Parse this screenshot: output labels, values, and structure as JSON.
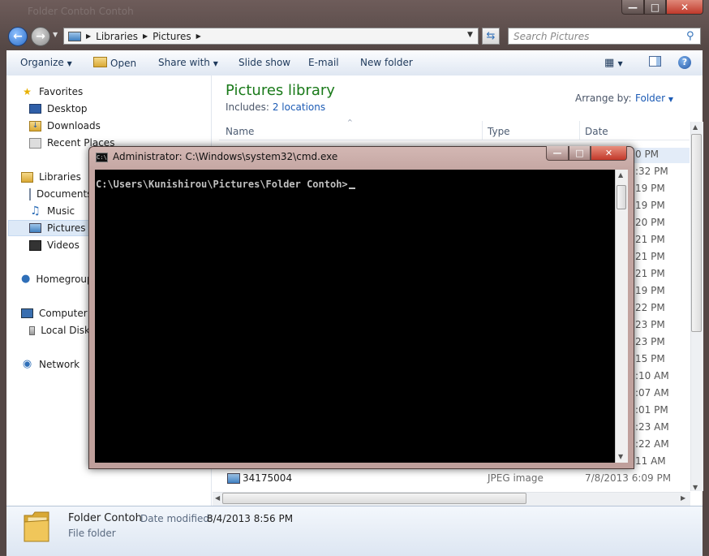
{
  "explorer": {
    "title_ghost": "Folder Contoh Contoh",
    "breadcrumb": [
      "Libraries",
      "Pictures"
    ],
    "search_placeholder": "Search Pictures",
    "toolbar": {
      "organize": "Organize",
      "open": "Open",
      "share_with": "Share with",
      "slide_show": "Slide show",
      "email": "E-mail",
      "new_folder": "New folder"
    },
    "nav": {
      "favorites": "Favorites",
      "desktop": "Desktop",
      "downloads": "Downloads",
      "recent_places": "Recent Places",
      "libraries": "Libraries",
      "documents": "Documents",
      "music": "Music",
      "pictures": "Pictures",
      "videos": "Videos",
      "homegroup": "Homegroup",
      "computer": "Computer",
      "local_disk": "Local Disk",
      "network": "Network"
    },
    "library": {
      "title": "Pictures library",
      "includes_label": "Includes:",
      "includes_link": "2 locations",
      "arrange_label": "Arrange by:",
      "arrange_value": "Folder"
    },
    "columns": {
      "name": "Name",
      "type": "Type",
      "date": "Date"
    },
    "visible_times": [
      "0 PM",
      ":32 PM",
      "19 PM",
      "19 PM",
      "20 PM",
      "21 PM",
      "21 PM",
      "21 PM",
      "19 PM",
      "22 PM",
      "23 PM",
      "23 PM",
      "15 PM",
      ":10 AM",
      ":07 AM",
      ":01 PM",
      ":23 AM",
      ":22 AM",
      "11 AM"
    ],
    "last_row": {
      "name": "34175004",
      "type": "JPEG image",
      "date": "7/8/2013 6:09 PM"
    },
    "details": {
      "name": "Folder Contoh",
      "modified_label": "Date modified:",
      "modified_value": "8/4/2013 8:56 PM",
      "kind": "File folder"
    }
  },
  "cmd": {
    "title": "Administrator: C:\\Windows\\system32\\cmd.exe",
    "prompt": "C:\\Users\\Kunishirou\\Pictures\\Folder Contoh>"
  }
}
